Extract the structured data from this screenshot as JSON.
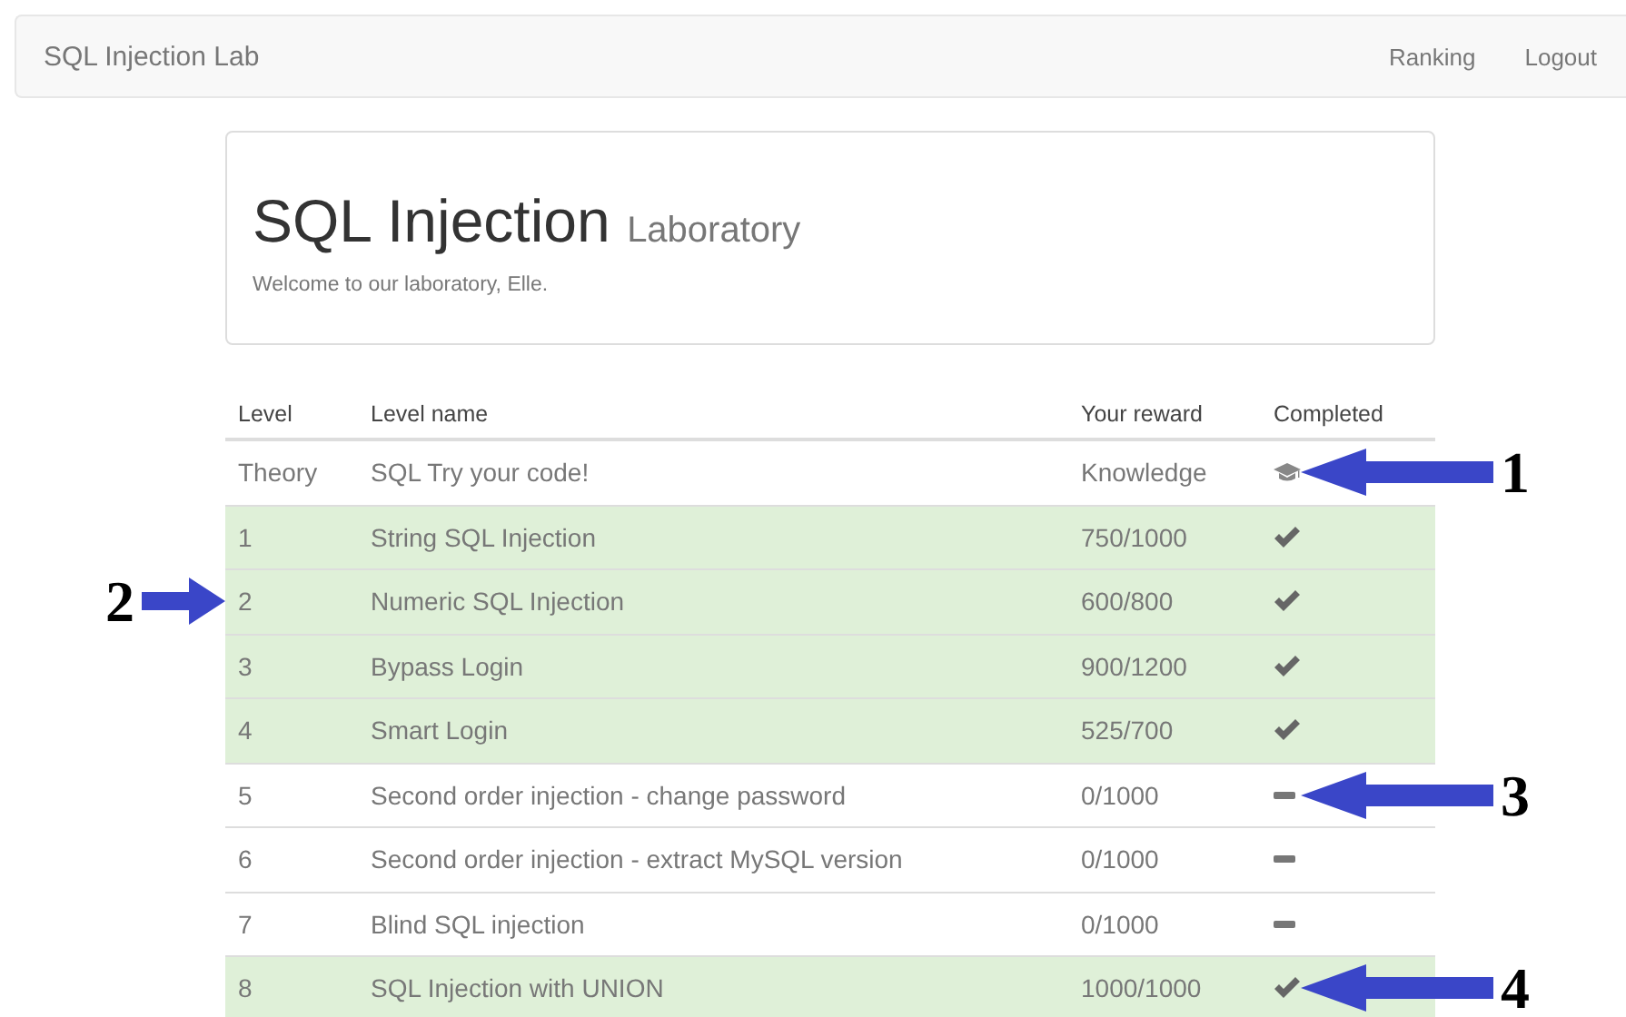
{
  "navbar": {
    "brand": "SQL Injection Lab",
    "links": [
      "Ranking",
      "Logout"
    ]
  },
  "header": {
    "title": "SQL Injection",
    "subtitle": "Laboratory",
    "welcome": "Welcome to our laboratory, Elle."
  },
  "table": {
    "columns": [
      "Level",
      "Level name",
      "Your reward",
      "Completed"
    ],
    "rows": [
      {
        "level": "Theory",
        "name": "SQL Try your code!",
        "reward": "Knowledge",
        "kind": "theory",
        "callout": {
          "label": "1",
          "kind": "right"
        }
      },
      {
        "level": "1",
        "name": "String SQL Injection",
        "reward": "750/1000",
        "kind": "done"
      },
      {
        "level": "2",
        "name": "Numeric SQL Injection",
        "reward": "600/800",
        "kind": "done",
        "callout": {
          "label": "2",
          "kind": "left"
        }
      },
      {
        "level": "3",
        "name": "Bypass Login",
        "reward": "900/1200",
        "kind": "done"
      },
      {
        "level": "4",
        "name": "Smart Login",
        "reward": "525/700",
        "kind": "done"
      },
      {
        "level": "5",
        "name": "Second order injection - change password",
        "reward": "0/1000",
        "kind": "pending",
        "callout": {
          "label": "3",
          "kind": "right"
        }
      },
      {
        "level": "6",
        "name": "Second order injection - extract MySQL version",
        "reward": "0/1000",
        "kind": "pending"
      },
      {
        "level": "7",
        "name": "Blind SQL injection",
        "reward": "0/1000",
        "kind": "pending"
      },
      {
        "level": "8",
        "name": "SQL Injection with UNION",
        "reward": "1000/1000",
        "kind": "done",
        "callout": {
          "label": "4",
          "kind": "right"
        }
      }
    ]
  }
}
